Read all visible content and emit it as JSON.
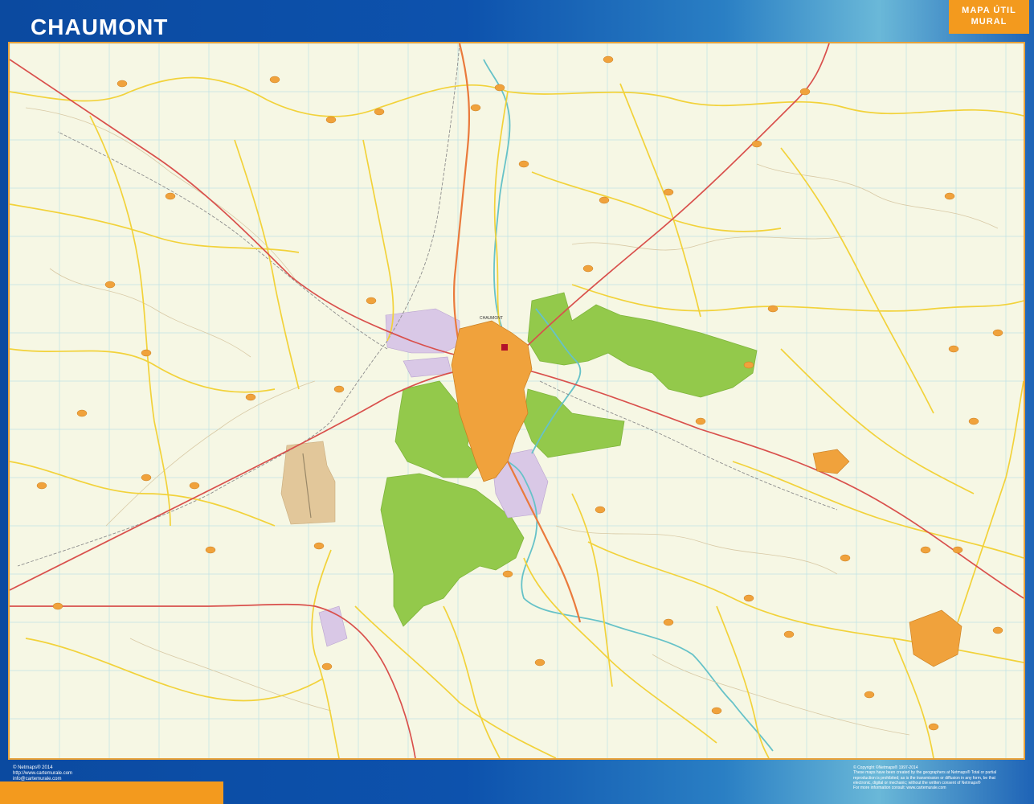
{
  "header": {
    "title": "CHAUMONT",
    "badge_line1": "MAPA ÚTIL",
    "badge_line2": "MURAL"
  },
  "map": {
    "city_label": "CHAUMONT",
    "colors": {
      "background": "#f6f7e4",
      "forest": "#93c94b",
      "urban": "#f0a23c",
      "industrial": "#d9c8e6",
      "airfield": "#e2c79a",
      "river": "#66c2c8",
      "major_road": "#d9504c",
      "road": "#f2d23a",
      "minor_road": "#d8c9a5",
      "railway": "#8c8c8c",
      "grid": "#b9dfe3"
    }
  },
  "footer": {
    "left": [
      "© Netmaps® 2014",
      "http://www.cartemurale.com",
      "info@cartemurale.com"
    ],
    "right": [
      "© Copyright ©Netmaps® 1997-2014",
      "These maps have been created by the geographers at Netmaps® Total or partial",
      "reproduction is prohibited; as is the transmission or diffusion in any form, be that",
      "electronic, digital or mechanic; without the written consent of Netmaps®",
      "For more information consult: www.cartemurale.com"
    ]
  }
}
